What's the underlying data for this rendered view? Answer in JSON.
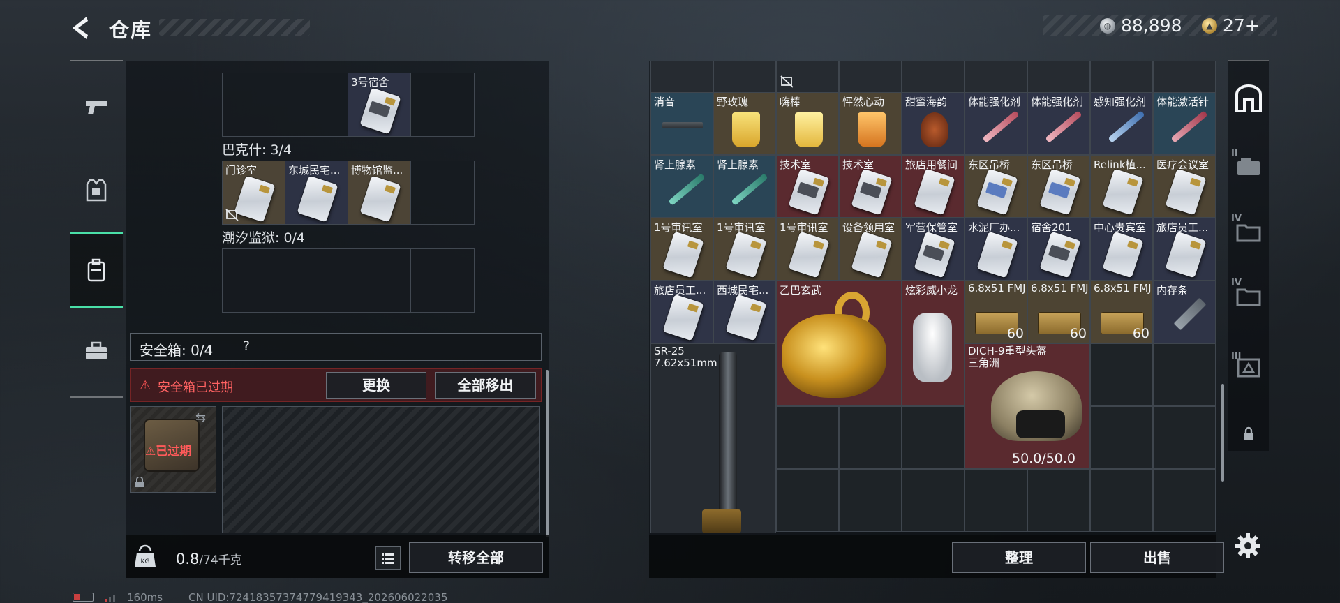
{
  "header": {
    "title": "仓库",
    "money": "88,898",
    "coupons": "27+"
  },
  "left_nav": {
    "items": [
      {
        "icon": "pistol-icon"
      },
      {
        "icon": "armor-vest-icon"
      },
      {
        "icon": "backpack-icon",
        "active": true
      },
      {
        "icon": "toolbox-icon"
      }
    ]
  },
  "keycard_groups": {
    "top_cells": [
      "",
      "",
      "3号宿舍",
      ""
    ],
    "bakeshi": {
      "label": "巴克什: 3/4",
      "cells": [
        "门诊室",
        "东城民宅...",
        "博物馆监...",
        ""
      ]
    },
    "chaoxi": {
      "label": "潮汐监狱: 0/4",
      "cells": [
        "",
        "",
        "",
        ""
      ]
    }
  },
  "safe_box": {
    "label": "安全箱: 0/4",
    "help": "?",
    "warning": "安全箱已过期",
    "replace_label": "更换",
    "move_all_label": "全部移出",
    "expired_badge": "已过期"
  },
  "left_footer": {
    "weight": "0.8",
    "weight_max": "/74千克",
    "transfer_label": "转移全部"
  },
  "inventory": {
    "row1": [
      {
        "label": "消音"
      },
      {
        "label": "野玫瑰"
      },
      {
        "label": "嗨棒"
      },
      {
        "label": "怦然心动"
      },
      {
        "label": "甜蜜海韵"
      },
      {
        "label": "体能强化剂"
      },
      {
        "label": "体能强化剂"
      },
      {
        "label": "感知强化剂"
      },
      {
        "label": "体能激活针"
      }
    ],
    "row2": [
      {
        "label": "肾上腺素"
      },
      {
        "label": "肾上腺素"
      },
      {
        "label": "技术室"
      },
      {
        "label": "技术室"
      },
      {
        "label": "旅店用餐间"
      },
      {
        "label": "东区吊桥"
      },
      {
        "label": "东区吊桥"
      },
      {
        "label": "Relink植..."
      },
      {
        "label": "医疗会议室"
      }
    ],
    "row3": [
      {
        "label": "1号审讯室"
      },
      {
        "label": "1号审讯室"
      },
      {
        "label": "1号审讯室"
      },
      {
        "label": "设备领用室"
      },
      {
        "label": "军营保管室"
      },
      {
        "label": "水泥厂办..."
      },
      {
        "label": "宿舍201"
      },
      {
        "label": "中心贵宾室"
      },
      {
        "label": "旅店员工..."
      }
    ],
    "row4": [
      {
        "label": "旅店员工..."
      },
      {
        "label": "西城民宅..."
      },
      {
        "label": "乙巴玄武"
      },
      {
        "label": "炫彩威小龙"
      },
      {
        "label": "6.8x51 FMJ",
        "count": "60"
      },
      {
        "label": "6.8x51 FMJ",
        "count": "60"
      },
      {
        "label": "6.8x51 FMJ",
        "count": "60"
      },
      {
        "label": "内存条"
      }
    ],
    "rifle": {
      "name": "SR-25",
      "caliber": "7.62x51mm"
    },
    "helmet": {
      "name": "DICH-9重型头盔",
      "origin": "三角洲",
      "durability": "50.0/50.0"
    }
  },
  "right_footer": {
    "sort_label": "整理",
    "sell_label": "出售"
  },
  "right_nav": {
    "items": [
      {
        "icon": "warehouse-icon",
        "active": true
      },
      {
        "icon": "storage-tab-2-icon",
        "tag": "II"
      },
      {
        "icon": "storage-tab-4a-icon",
        "tag": "IV"
      },
      {
        "icon": "storage-tab-4b-icon",
        "tag": "IV"
      },
      {
        "icon": "storage-tab-3-icon",
        "tag": "III"
      },
      {
        "icon": "locked-tab-icon"
      }
    ]
  },
  "status": {
    "ping": "160ms",
    "uid": "CN UID:72418357374779419343_202606022035"
  },
  "colors": {
    "accent": "#4ae0a8",
    "warning_red": "#ff5454",
    "cell_blue": "#2a4556",
    "cell_tan": "#4d4433",
    "cell_red": "#5a2a2f"
  }
}
